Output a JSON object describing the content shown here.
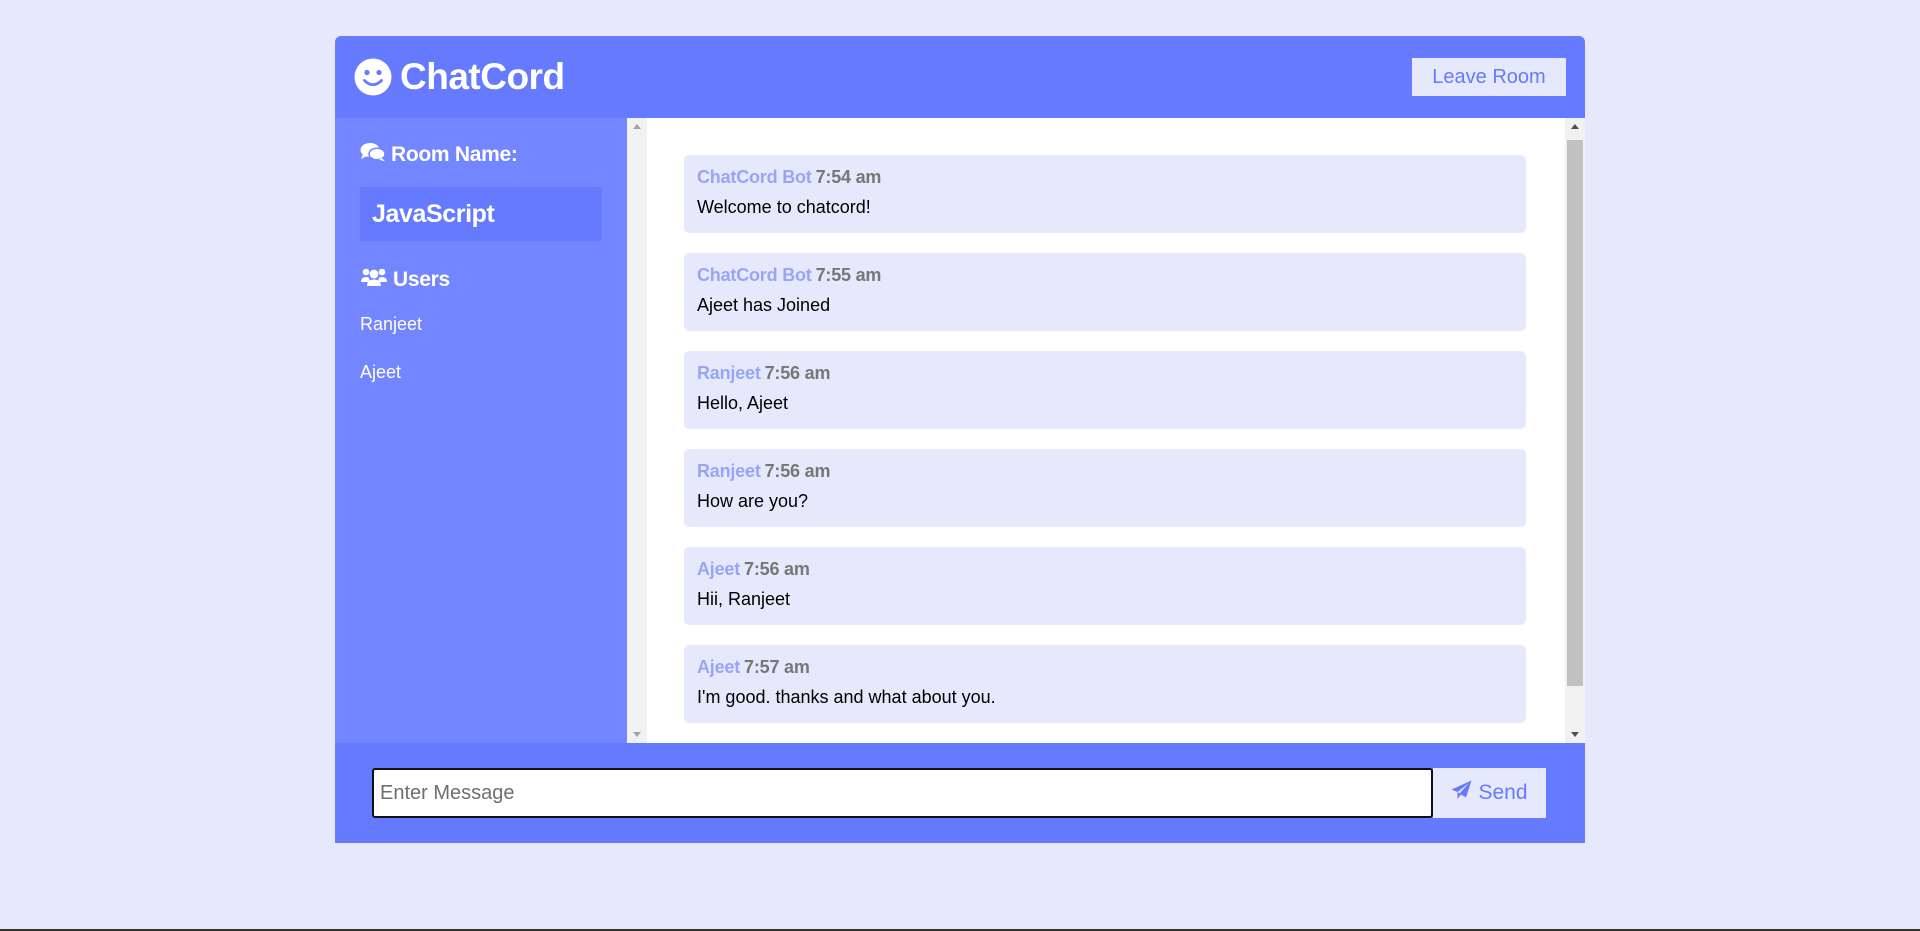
{
  "header": {
    "title": "ChatCord",
    "leave_label": "Leave Room"
  },
  "sidebar": {
    "room_heading": "Room Name:",
    "room_name": "JavaScript",
    "users_heading": "Users",
    "users": [
      "Ranjeet",
      "Ajeet"
    ]
  },
  "messages": [
    {
      "user": "ChatCord Bot",
      "time": "7:54 am",
      "text": "Welcome to chatcord!"
    },
    {
      "user": "ChatCord Bot",
      "time": "7:55 am",
      "text": "Ajeet has Joined"
    },
    {
      "user": "Ranjeet",
      "time": "7:56 am",
      "text": "Hello, Ajeet"
    },
    {
      "user": "Ranjeet",
      "time": "7:56 am",
      "text": "How are you?"
    },
    {
      "user": "Ajeet",
      "time": "7:56 am",
      "text": "Hii, Ranjeet"
    },
    {
      "user": "Ajeet",
      "time": "7:57 am",
      "text": "I'm good. thanks and what about you."
    }
  ],
  "form": {
    "placeholder": "Enter Message",
    "value": "",
    "send_label": "Send"
  },
  "colors": {
    "primary": "#667aff",
    "secondary": "#7386ff",
    "light": "#e6e9fc"
  }
}
